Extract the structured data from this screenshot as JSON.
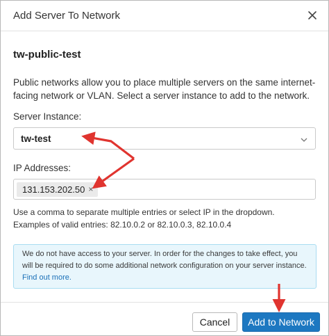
{
  "dialog": {
    "title": "Add Server To Network",
    "close_icon": "close-icon",
    "network_name": "tw-public-test",
    "description": "Public networks allow you to place multiple servers on the same internet-facing network or VLAN. Select a server instance to add to the network."
  },
  "server_instance": {
    "label": "Server Instance:",
    "selected": "tw-test",
    "icon": "chevron-down-icon"
  },
  "ip_addresses": {
    "label": "IP Addresses:",
    "chips": [
      {
        "value": "131.153.202.50",
        "remove": "×"
      }
    ],
    "hint_line1": "Use a comma to separate multiple entries or select IP in the dropdown.",
    "hint_line2": "Examples of valid entries: 82.10.0.2 or 82.10.0.3, 82.10.0.4"
  },
  "notice": {
    "text": "We do not have access to your server. In order for the changes to take effect, you will be required to do some additional network configuration on your server instance.",
    "link": "Find out more."
  },
  "footer": {
    "cancel_label": "Cancel",
    "submit_label": "Add to Network"
  },
  "colors": {
    "primary": "#1d78c1",
    "info_bg": "#e8f6fc",
    "info_border": "#a9dcf1",
    "annotation_arrow": "#e0342f"
  }
}
